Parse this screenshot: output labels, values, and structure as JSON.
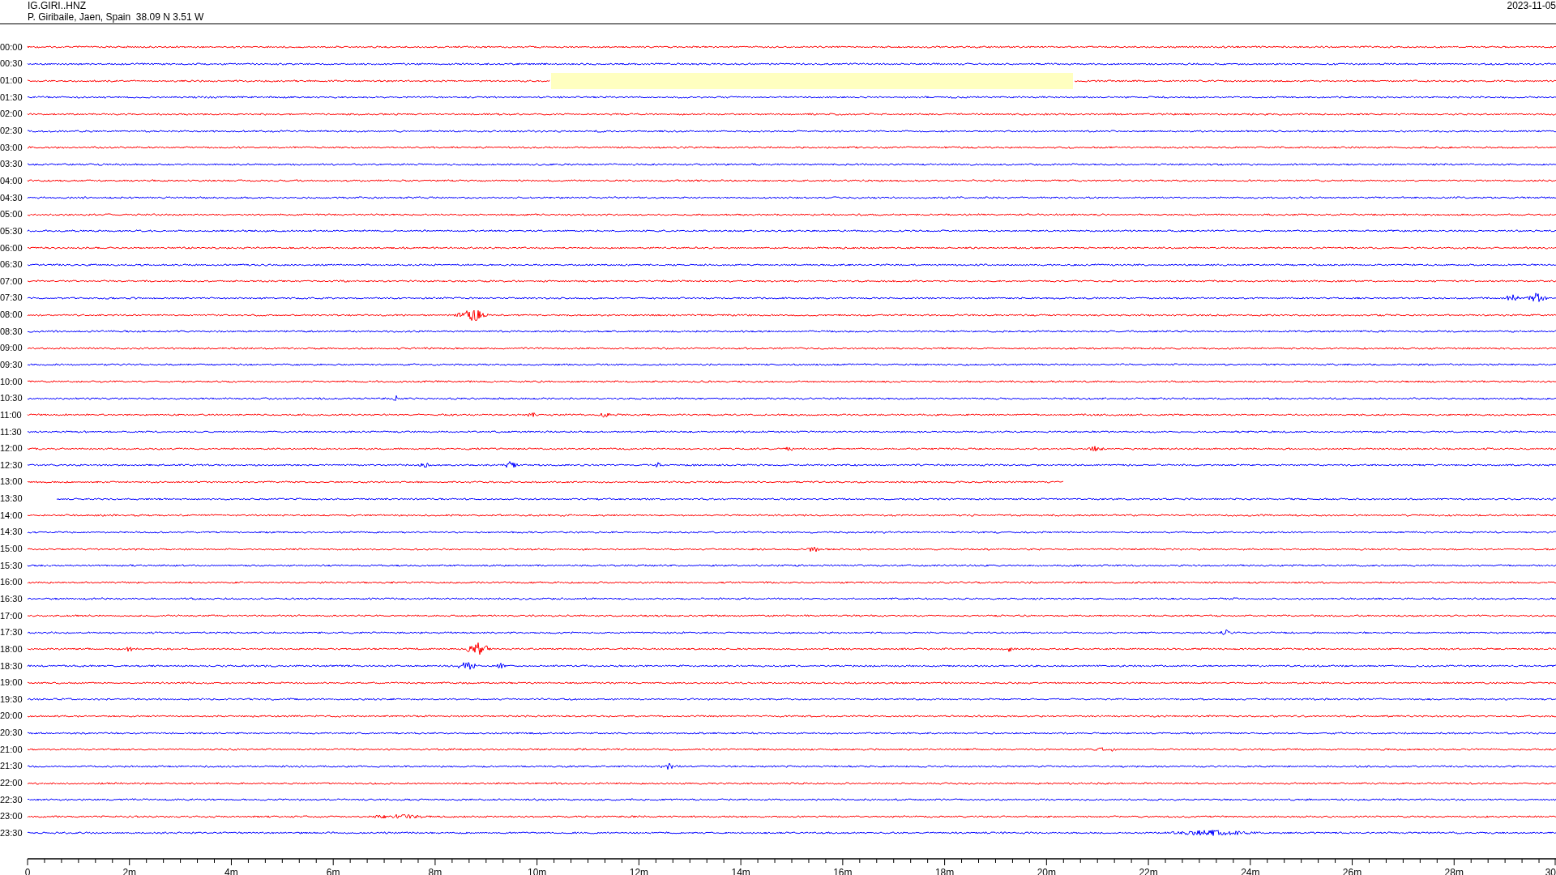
{
  "header": {
    "channel": "IG.GIRI..HNZ",
    "station": "P. Giribaile, Jaen, Spain  38.09 N 3.51 W",
    "date": "2023-11-05"
  },
  "rows": [
    {
      "time": "00:00",
      "color": "#ff0000",
      "kind": "full"
    },
    {
      "time": "00:30",
      "color": "#0000ff",
      "kind": "full"
    },
    {
      "time": "01:00",
      "color": "#ff0000",
      "kind": "gap"
    },
    {
      "time": "01:30",
      "color": "#0000ff",
      "kind": "full"
    },
    {
      "time": "02:00",
      "color": "#ff0000",
      "kind": "full"
    },
    {
      "time": "02:30",
      "color": "#0000ff",
      "kind": "full"
    },
    {
      "time": "03:00",
      "color": "#ff0000",
      "kind": "full"
    },
    {
      "time": "03:30",
      "color": "#0000ff",
      "kind": "full"
    },
    {
      "time": "04:00",
      "color": "#ff0000",
      "kind": "full"
    },
    {
      "time": "04:30",
      "color": "#0000ff",
      "kind": "full"
    },
    {
      "time": "05:00",
      "color": "#ff0000",
      "kind": "full"
    },
    {
      "time": "05:30",
      "color": "#0000ff",
      "kind": "full"
    },
    {
      "time": "06:00",
      "color": "#ff0000",
      "kind": "full"
    },
    {
      "time": "06:30",
      "color": "#0000ff",
      "kind": "full"
    },
    {
      "time": "07:00",
      "color": "#ff0000",
      "kind": "full"
    },
    {
      "time": "07:30",
      "color": "#0000ff",
      "kind": "full"
    },
    {
      "time": "08:00",
      "color": "#ff0000",
      "kind": "full"
    },
    {
      "time": "08:30",
      "color": "#0000ff",
      "kind": "full"
    },
    {
      "time": "09:00",
      "color": "#ff0000",
      "kind": "full"
    },
    {
      "time": "09:30",
      "color": "#0000ff",
      "kind": "full"
    },
    {
      "time": "10:00",
      "color": "#ff0000",
      "kind": "full"
    },
    {
      "time": "10:30",
      "color": "#0000ff",
      "kind": "full"
    },
    {
      "time": "11:00",
      "color": "#ff0000",
      "kind": "full"
    },
    {
      "time": "11:30",
      "color": "#0000ff",
      "kind": "full"
    },
    {
      "time": "12:00",
      "color": "#ff0000",
      "kind": "full"
    },
    {
      "time": "12:30",
      "color": "#0000ff",
      "kind": "full"
    },
    {
      "time": "13:00",
      "color": "#ff0000",
      "kind": "ends-early"
    },
    {
      "time": "13:30",
      "color": "#0000ff",
      "kind": "starts-late"
    },
    {
      "time": "14:00",
      "color": "#ff0000",
      "kind": "full"
    },
    {
      "time": "14:30",
      "color": "#0000ff",
      "kind": "full"
    },
    {
      "time": "15:00",
      "color": "#ff0000",
      "kind": "full"
    },
    {
      "time": "15:30",
      "color": "#0000ff",
      "kind": "full"
    },
    {
      "time": "16:00",
      "color": "#ff0000",
      "kind": "full"
    },
    {
      "time": "16:30",
      "color": "#0000ff",
      "kind": "full"
    },
    {
      "time": "17:00",
      "color": "#ff0000",
      "kind": "full"
    },
    {
      "time": "17:30",
      "color": "#0000ff",
      "kind": "full"
    },
    {
      "time": "18:00",
      "color": "#ff0000",
      "kind": "full"
    },
    {
      "time": "18:30",
      "color": "#0000ff",
      "kind": "full"
    },
    {
      "time": "19:00",
      "color": "#ff0000",
      "kind": "full"
    },
    {
      "time": "19:30",
      "color": "#0000ff",
      "kind": "full"
    },
    {
      "time": "20:00",
      "color": "#ff0000",
      "kind": "full"
    },
    {
      "time": "20:30",
      "color": "#0000ff",
      "kind": "full"
    },
    {
      "time": "21:00",
      "color": "#ff0000",
      "kind": "full"
    },
    {
      "time": "21:30",
      "color": "#0000ff",
      "kind": "full"
    },
    {
      "time": "22:00",
      "color": "#ff0000",
      "kind": "full"
    },
    {
      "time": "22:30",
      "color": "#0000ff",
      "kind": "full"
    },
    {
      "time": "23:00",
      "color": "#ff0000",
      "kind": "full"
    },
    {
      "time": "23:30",
      "color": "#0000ff",
      "kind": "full"
    }
  ],
  "x_axis": {
    "tick_labels": [
      "0",
      "2m",
      "4m",
      "6m",
      "8m",
      "10m",
      "12m",
      "14m",
      "16m",
      "18m",
      "20m",
      "22m",
      "24m",
      "26m",
      "28m",
      "30"
    ]
  }
}
